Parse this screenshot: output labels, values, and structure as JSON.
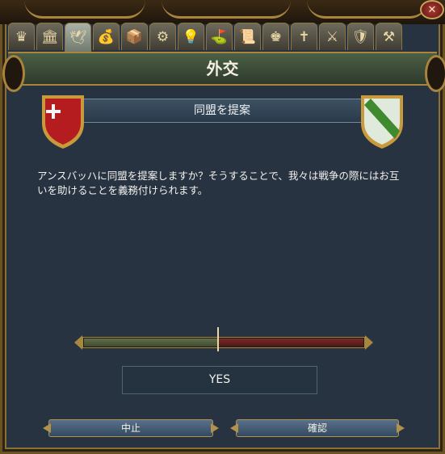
{
  "window": {
    "title": "外交",
    "close_label": "✕"
  },
  "tabs": [
    {
      "name": "crown",
      "glyph": "♛",
      "active": false
    },
    {
      "name": "government",
      "glyph": "🏛",
      "active": false
    },
    {
      "name": "diplomacy-dove",
      "glyph": "🕊",
      "active": true
    },
    {
      "name": "economy",
      "glyph": "💰",
      "active": false
    },
    {
      "name": "trade",
      "glyph": "📦",
      "active": false
    },
    {
      "name": "production",
      "glyph": "⚙",
      "active": false
    },
    {
      "name": "ideas",
      "glyph": "💡",
      "active": false
    },
    {
      "name": "missions",
      "glyph": "⛳",
      "active": false
    },
    {
      "name": "decisions",
      "glyph": "📜",
      "active": false
    },
    {
      "name": "estates",
      "glyph": "♚",
      "active": false
    },
    {
      "name": "religion",
      "glyph": "✝",
      "active": false
    },
    {
      "name": "military",
      "glyph": "⚔",
      "active": false
    },
    {
      "name": "subjects",
      "glyph": "🛡",
      "active": false
    },
    {
      "name": "options",
      "glyph": "⚒",
      "active": false
    }
  ],
  "proposal": {
    "heading": "同盟を提案",
    "description": "アンスバッハに同盟を提案しますか？そうすることで、我々は戦争の際にはお互いを助けることを義務付けられます。",
    "acceptance_fraction": 0.48,
    "result": "YES"
  },
  "shields": {
    "left": {
      "base": "#b51c1f",
      "cross": "#f4f4f4"
    },
    "right": {
      "base": "#dfe9dc",
      "band": "#3f8a2e"
    }
  },
  "buttons": {
    "cancel": "中止",
    "confirm": "確認"
  }
}
